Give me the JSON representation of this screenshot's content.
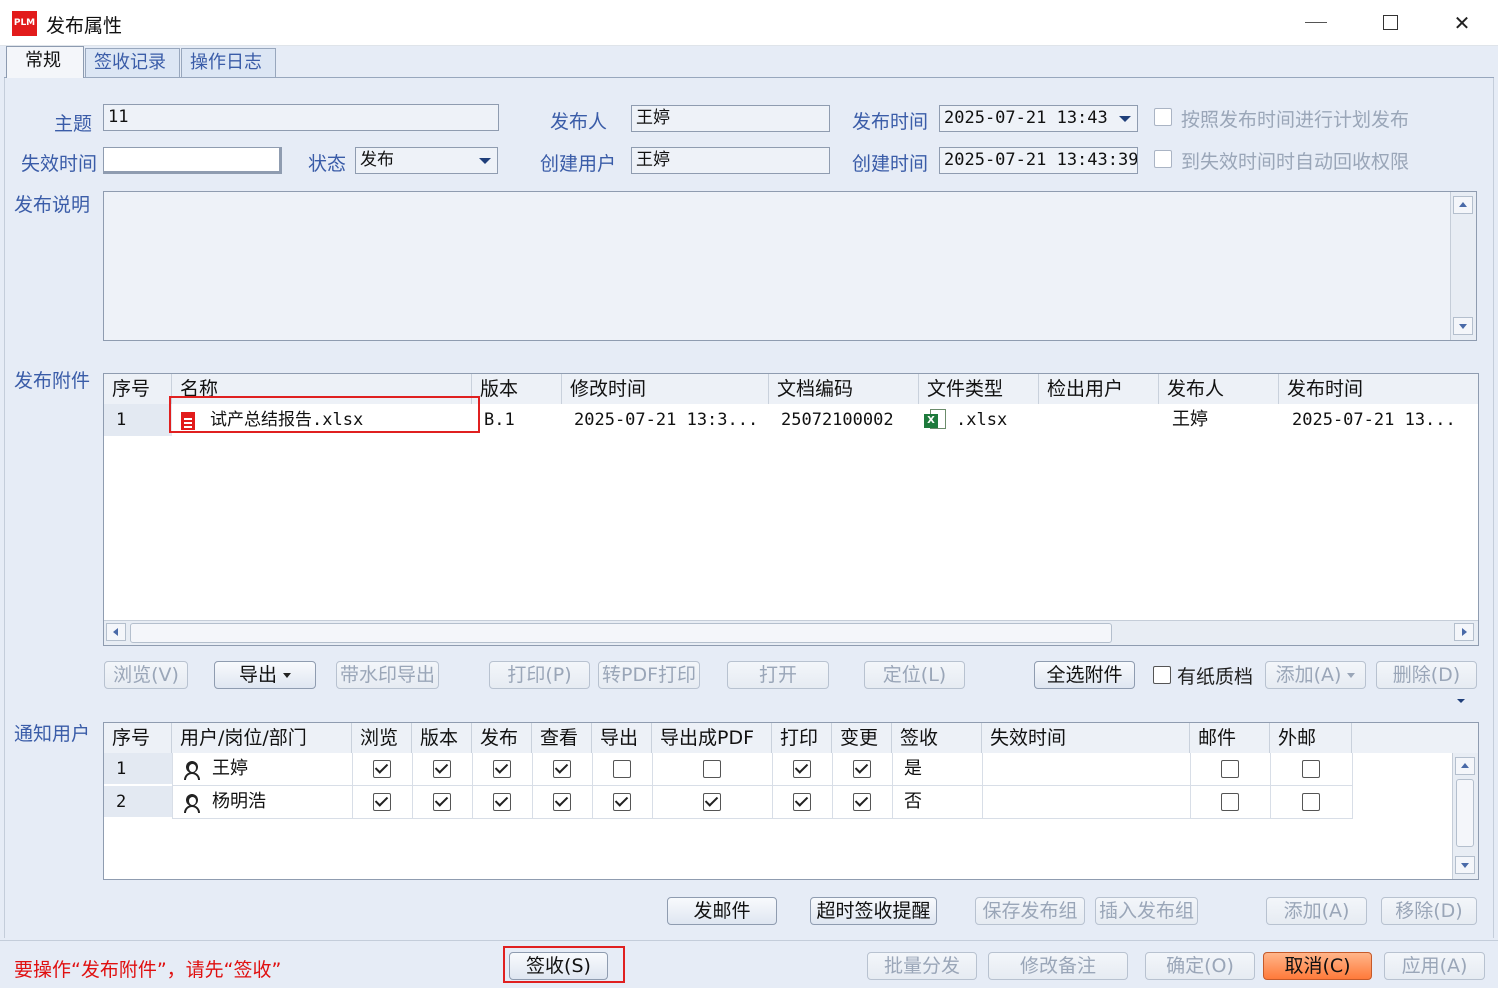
{
  "window": {
    "title": "发布属性",
    "logo": "PLM"
  },
  "tabs": [
    "常规",
    "签收记录",
    "操作日志"
  ],
  "form": {
    "subject_label": "主题",
    "subject_value": "11",
    "publisher_label": "发布人",
    "publisher_value": "王婷",
    "publish_time_label": "发布时间",
    "publish_time_value": "2025-07-21  13:43",
    "plan_publish_label": "按照发布时间进行计划发布",
    "expire_time_label": "失效时间",
    "expire_time_value": "",
    "status_label": "状态",
    "status_value": "发布",
    "create_user_label": "创建用户",
    "create_user_value": "王婷",
    "create_time_label": "创建时间",
    "create_time_value": "2025-07-21  13:43:39",
    "auto_revoke_label": "到失效时间时自动回收权限",
    "description_label": "发布说明",
    "description_value": ""
  },
  "attachments": {
    "label": "发布附件",
    "columns": [
      "序号",
      "名称",
      "版本",
      "修改时间",
      "文档编码",
      "文件类型",
      "检出用户",
      "发布人",
      "发布时间"
    ],
    "rows": [
      {
        "no": "1",
        "name": "试产总结报告.xlsx",
        "version": "B.1",
        "modified": "2025-07-21  13:3...",
        "code": "25072100002",
        "type": ".xlsx",
        "checkout": "",
        "publisher": "王婷",
        "publish_time": "2025-07-21  13..."
      }
    ]
  },
  "attach_buttons": {
    "browse": "浏览(V)",
    "export": "导出",
    "watermark_export": "带水印导出",
    "print": "打印(P)",
    "pdf_print": "转PDF打印",
    "open": "打开",
    "locate": "定位(L)",
    "select_all": "全选附件",
    "paper_doc": "有纸质档",
    "add": "添加(A)",
    "delete": "删除(D)"
  },
  "notify": {
    "label": "通知用户",
    "columns": [
      "序号",
      "用户/岗位/部门",
      "浏览",
      "版本",
      "发布",
      "查看",
      "导出",
      "导出成PDF",
      "打印",
      "变更",
      "签收",
      "失效时间",
      "邮件",
      "外邮"
    ],
    "rows": [
      {
        "no": "1",
        "user": "王婷",
        "signed": "是",
        "checks": [
          true,
          true,
          true,
          true,
          false,
          false,
          true,
          true
        ],
        "mail": false,
        "external": false
      },
      {
        "no": "2",
        "user": "杨明浩",
        "signed": "否",
        "checks": [
          true,
          true,
          true,
          true,
          true,
          true,
          true,
          true
        ],
        "mail": false,
        "external": false
      }
    ]
  },
  "notify_buttons": {
    "send_mail": "发邮件",
    "overdue_remind": "超时签收提醒",
    "save_group": "保存发布组",
    "insert_group": "插入发布组",
    "add": "添加(A)",
    "remove": "移除(D)"
  },
  "footer": {
    "warning": "要操作“发布附件”，请先“签收”",
    "sign": "签收(S)",
    "batch": "批量分发",
    "edit_note": "修改备注",
    "ok": "确定(O)",
    "cancel": "取消(C)",
    "apply": "应用(A)"
  },
  "colors": {
    "accent_label": "#3a5ca8",
    "warning": "#e01010",
    "cancel_button": "#ff7a3a",
    "highlight_box": "#e02020"
  }
}
